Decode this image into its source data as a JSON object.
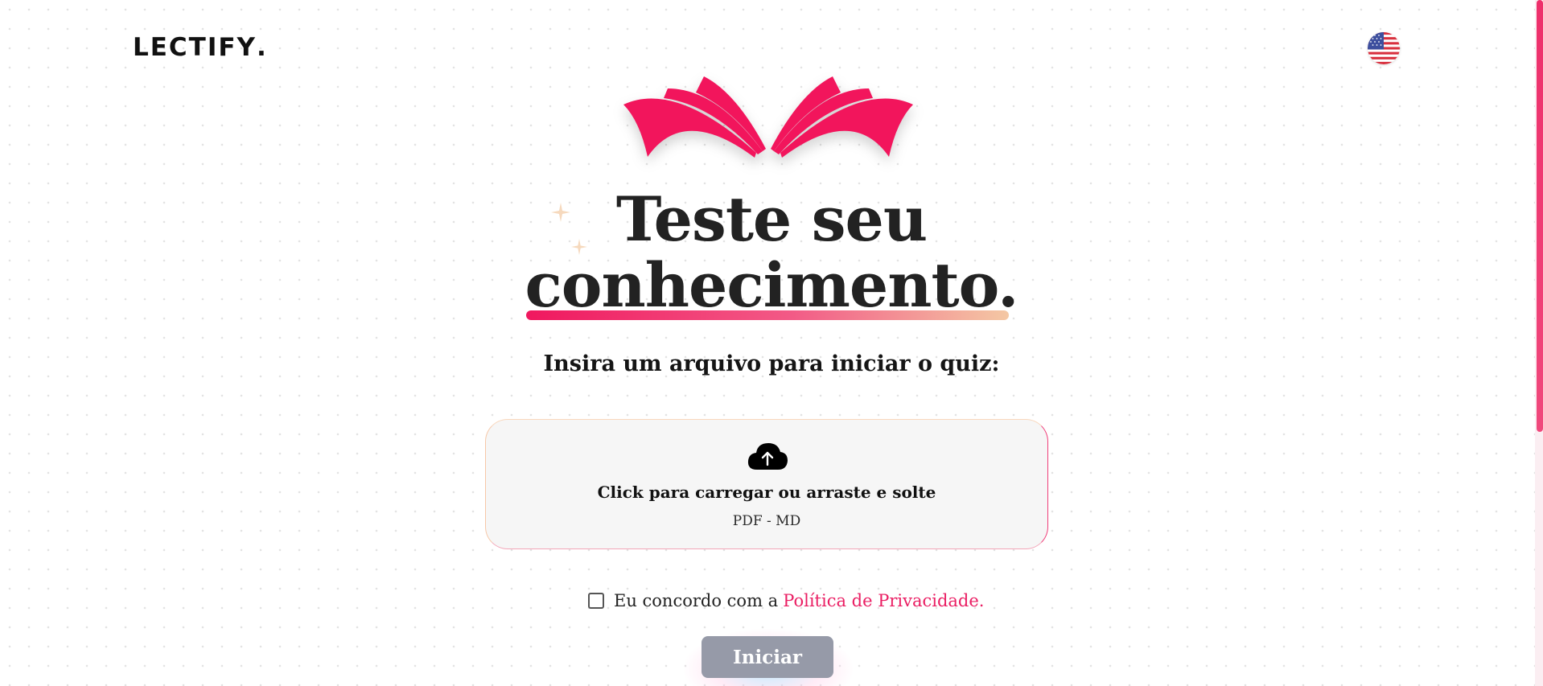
{
  "header": {
    "logo_text": "LECTIFY",
    "logo_dot": ".",
    "language_icon": "us-flag-icon"
  },
  "hero": {
    "logo_icon": "open-book-icon",
    "title_line1": "Teste seu",
    "title_line2": "conhecimento.",
    "subtitle": "Insira um arquivo para iniciar o quiz:"
  },
  "upload": {
    "icon": "cloud-upload-icon",
    "title": "Click para carregar ou arraste e solte",
    "formats": "PDF - MD"
  },
  "consent": {
    "checked": false,
    "text": "Eu concordo com a",
    "link_text": "Política de Privacidade."
  },
  "actions": {
    "start_label": "Iniciar"
  },
  "colors": {
    "accent": "#ea1e63",
    "button_disabled": "#969aa8",
    "text": "#1f1f1f"
  }
}
